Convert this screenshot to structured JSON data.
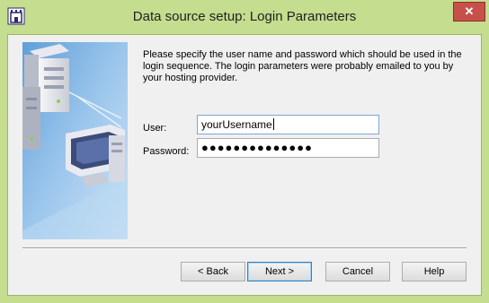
{
  "window": {
    "title": "Data source setup: Login Parameters",
    "close_label": "✕"
  },
  "page": {
    "instructions": "Please specify the user name and password which should be used in the login sequence. The login parameters were probably emailed to you by your hosting provider."
  },
  "form": {
    "user_label": "User:",
    "user_value": "yourUsername",
    "password_label": "Password:",
    "password_value": "●●●●●●●●●●●●●●"
  },
  "buttons": {
    "back": "< Back",
    "next": "Next >",
    "cancel": "Cancel",
    "help": "Help"
  },
  "icons": {
    "app": "castle-tower-icon",
    "close": "close-icon",
    "illustration": "servers-computer-illustration"
  },
  "colors": {
    "frame": "#c4dd8e",
    "close": "#c7504b",
    "illustration_bg": "#9cc6ec"
  }
}
